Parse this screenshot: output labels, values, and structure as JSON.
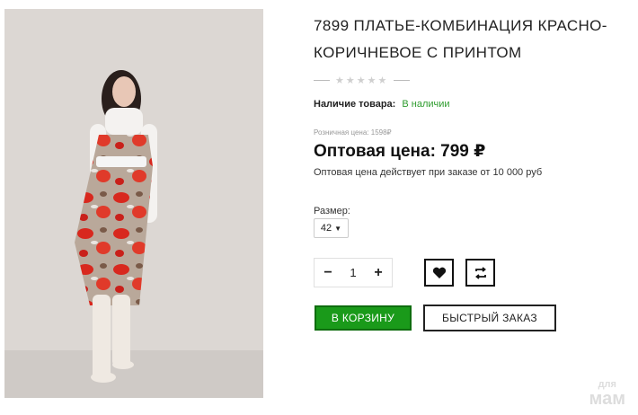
{
  "product": {
    "title": "7899 ПЛАТЬЕ-КОМБИНАЦИЯ КРАСНО-КОРИЧНЕВОЕ С ПРИНТОМ",
    "stars": "★★★★★",
    "availability_label": "Наличие товара:",
    "availability_value": "В наличии",
    "retail_price": "Розничная цена: 1598₽",
    "wholesale_price": "Оптовая цена: 799 ₽",
    "wholesale_note": "Оптовая цена действует при заказе от 10 000 руб"
  },
  "options": {
    "size_label": "Размер:",
    "size_value": "42"
  },
  "quantity": {
    "minus": "−",
    "value": "1",
    "plus": "+"
  },
  "actions": {
    "wishlist_icon": "heart-icon",
    "compare_icon": "compare-arrows-icon",
    "cart_label": "В КОРЗИНУ",
    "quick_order_label": "БЫСТРЫЙ ЗАКАЗ"
  },
  "watermark": {
    "line1": "для",
    "line2": "мам"
  },
  "colors": {
    "accent_green": "#1a9a1a",
    "in_stock_green": "#2e9c2e"
  }
}
